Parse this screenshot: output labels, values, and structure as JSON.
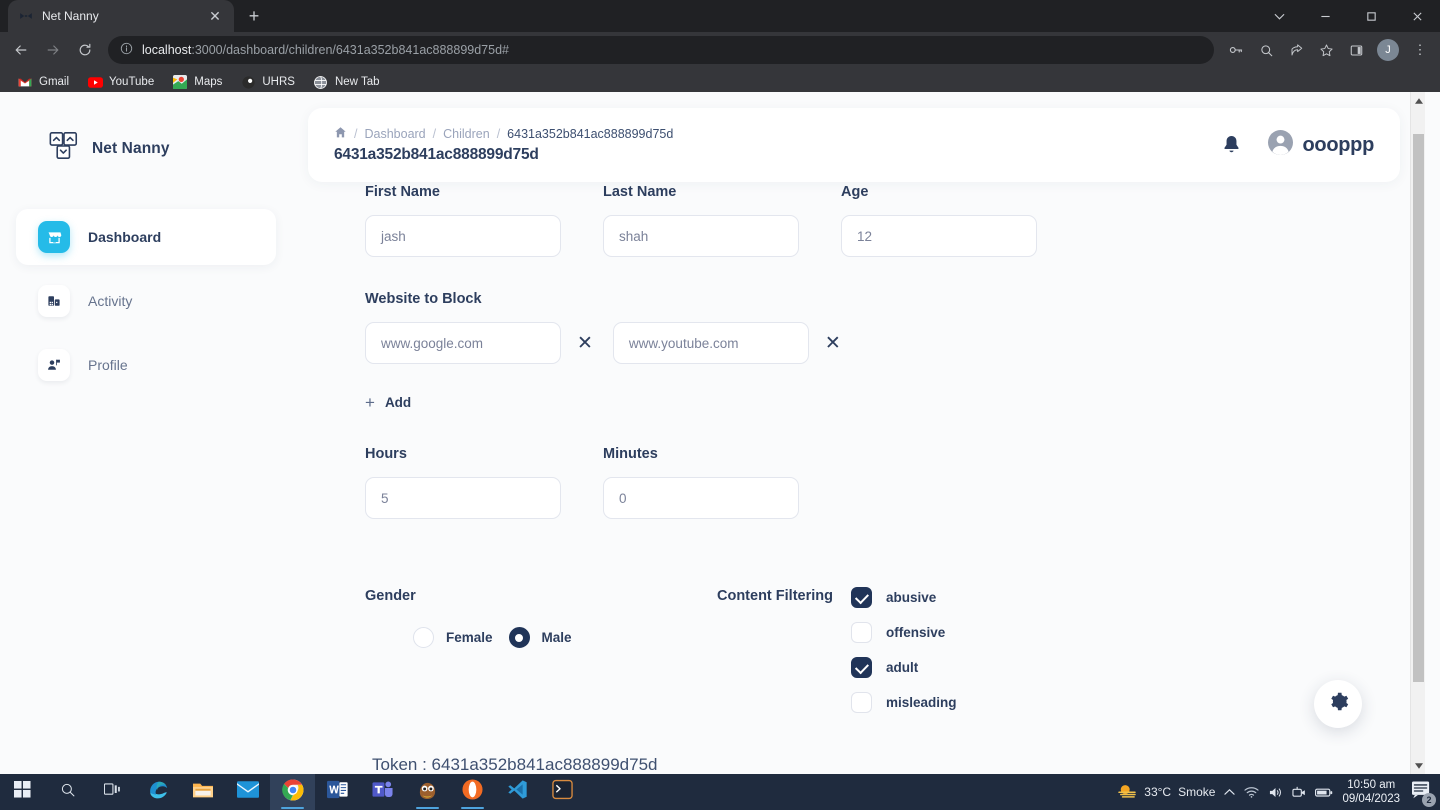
{
  "browser": {
    "tab": {
      "title": "Net Nanny",
      "favicon": "netnanny-favicon",
      "close_label": "✕"
    },
    "new_tab_label": "+",
    "window_controls": {
      "tab_search": "⌄",
      "minimize": "—",
      "maximize": "❐",
      "close": "✕"
    },
    "nav": {
      "back": "←",
      "forward": "→",
      "reload": "⟳"
    },
    "omnibox": {
      "info_icon": "ⓘ",
      "url_host": "localhost",
      "url_rest": ":3000/dashboard/children/6431a352b841ac888899d75d#"
    },
    "toolbar_icons": [
      "password-key-icon",
      "search-icon",
      "share-icon",
      "bookmark-star-icon",
      "side-panel-icon"
    ],
    "profile_initial": "J",
    "menu_icon": "⋮",
    "bookmarks": [
      {
        "label": "Gmail",
        "icon": "gmail-icon"
      },
      {
        "label": "YouTube",
        "icon": "youtube-icon"
      },
      {
        "label": "Maps",
        "icon": "maps-icon"
      },
      {
        "label": "UHRS",
        "icon": "uhrs-icon"
      },
      {
        "label": "New Tab",
        "icon": "globe-icon"
      }
    ]
  },
  "sidebar": {
    "brand": "Net Nanny",
    "items": [
      {
        "label": "Dashboard",
        "icon": "shop-icon",
        "active": true
      },
      {
        "label": "Activity",
        "icon": "chart-icon",
        "active": false
      },
      {
        "label": "Profile",
        "icon": "person-flag-icon",
        "active": false
      }
    ]
  },
  "header": {
    "breadcrumb": {
      "home_icon": "home-icon",
      "items": [
        "Dashboard",
        "Children",
        "6431a352b841ac888899d75d"
      ],
      "separator": "/"
    },
    "title": "6431a352b841ac888899d75d",
    "bell_icon": "bell-icon",
    "username": "oooppp"
  },
  "form": {
    "first_name": {
      "label": "First Name",
      "value": "jash"
    },
    "last_name": {
      "label": "Last Name",
      "value": "shah"
    },
    "age": {
      "label": "Age",
      "value": "12"
    },
    "website_block": {
      "label": "Website to Block",
      "entries": [
        {
          "value": "www.google.com",
          "remove_label": "✕"
        },
        {
          "value": "www.youtube.com",
          "remove_label": "✕"
        }
      ],
      "add_plus": "+",
      "add_label": "Add"
    },
    "hours": {
      "label": "Hours",
      "value": "5"
    },
    "minutes": {
      "label": "Minutes",
      "value": "0"
    },
    "gender": {
      "label": "Gender",
      "options": [
        {
          "label": "Female",
          "selected": false
        },
        {
          "label": "Male",
          "selected": true
        }
      ]
    },
    "content_filtering": {
      "label": "Content Filtering",
      "options": [
        {
          "label": "abusive",
          "checked": true
        },
        {
          "label": "offensive",
          "checked": false
        },
        {
          "label": "adult",
          "checked": true
        },
        {
          "label": "misleading",
          "checked": false
        }
      ]
    },
    "token": "Token : 6431a352b841ac888899d75d"
  },
  "fab": {
    "icon": "gear-icon"
  },
  "taskbar": {
    "items": [
      {
        "name": "start-button",
        "icon": "windows-logo"
      },
      {
        "name": "search-button",
        "icon": "search-icon"
      },
      {
        "name": "task-view-button",
        "icon": "task-view-icon"
      },
      {
        "name": "edge-app",
        "icon": "edge-icon"
      },
      {
        "name": "file-explorer-app",
        "icon": "folder-icon"
      },
      {
        "name": "mail-app",
        "icon": "mail-icon"
      },
      {
        "name": "chrome-app",
        "icon": "chrome-icon"
      },
      {
        "name": "word-app",
        "icon": "word-icon"
      },
      {
        "name": "teams-app",
        "icon": "teams-icon"
      },
      {
        "name": "gimp-app",
        "icon": "gimp-icon"
      },
      {
        "name": "opera-app",
        "icon": "opera-icon"
      },
      {
        "name": "vscode-app",
        "icon": "vscode-icon"
      },
      {
        "name": "terminal-app",
        "icon": "terminal-icon"
      }
    ],
    "tray": {
      "weather_temp": "33°C",
      "weather_cond": "Smoke",
      "chevron": "⌃",
      "wifi_icon": "wifi-icon",
      "volume_icon": "volume-icon",
      "camera_icon": "camera-icon",
      "battery_icon": "battery-icon",
      "time": "10:50 am",
      "date": "09/04/2023",
      "notification_count": "2"
    }
  },
  "colors": {
    "accent_cyan": "#25bbe8",
    "navy": "#2d3e5e",
    "control_dark": "#203458",
    "page_bg": "#fafbfc",
    "chrome_bg": "#202124",
    "taskbar_bg": "#1f2b3e"
  }
}
